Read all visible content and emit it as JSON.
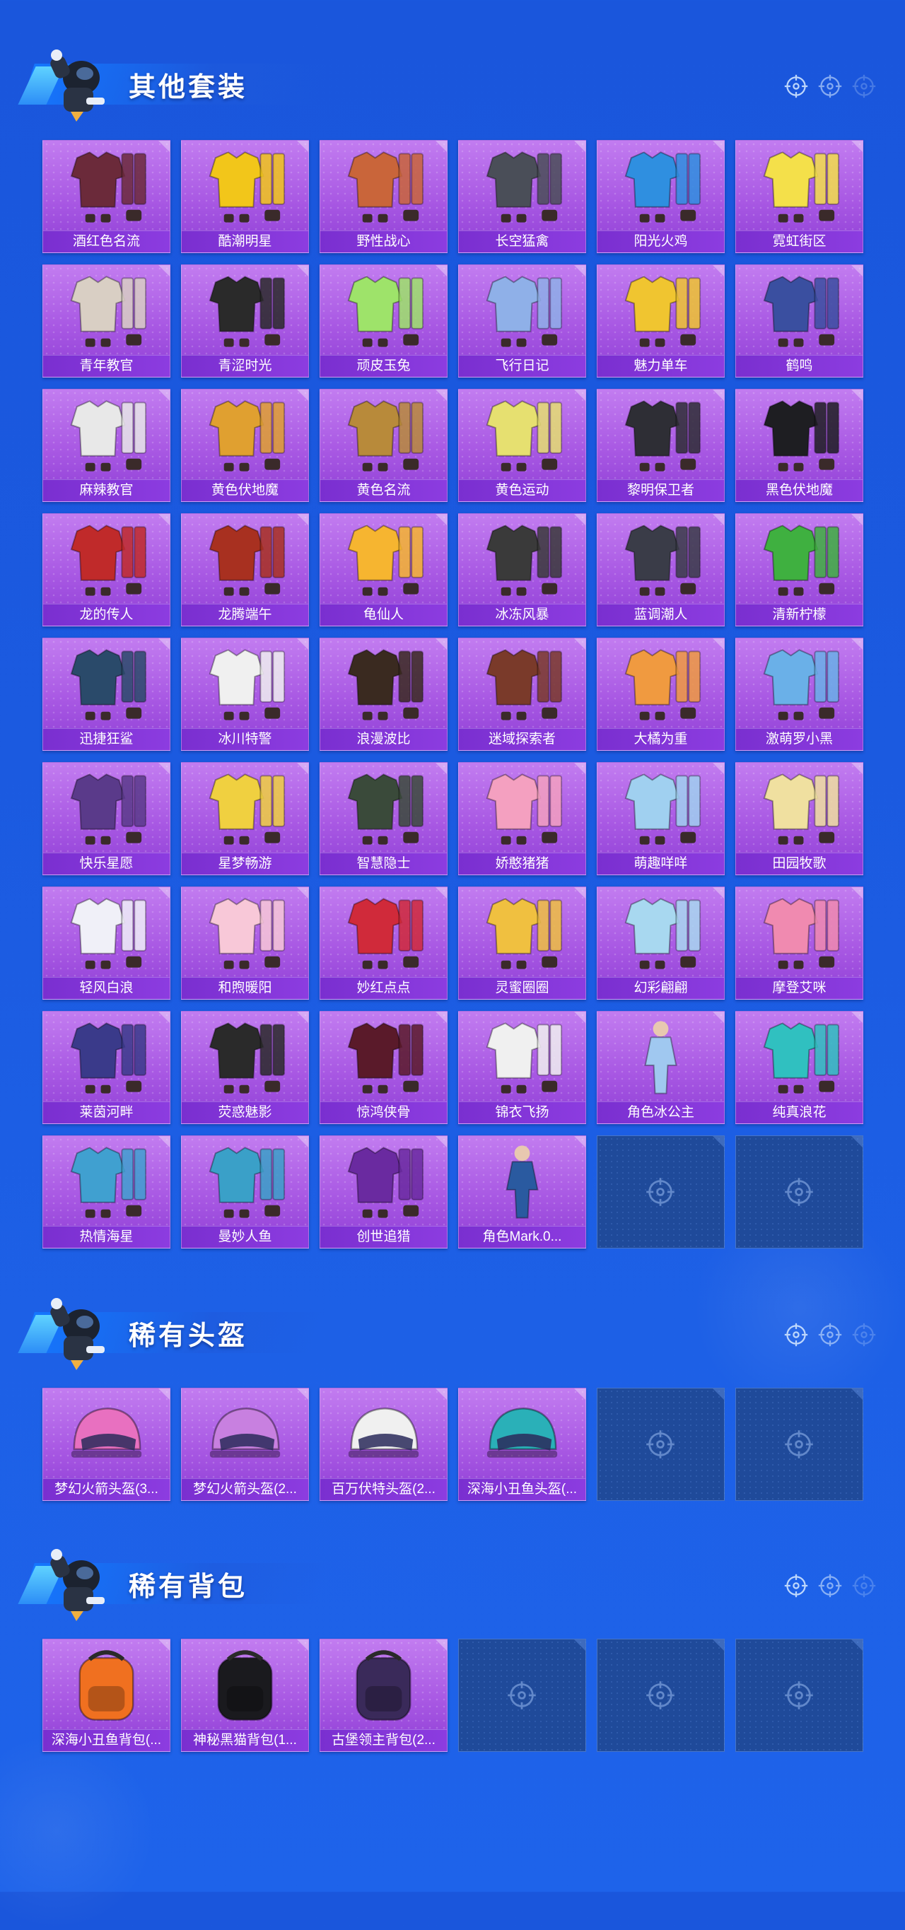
{
  "colors": {
    "background": "#1b5ae0",
    "card_top": "#c27cf0",
    "card_bottom": "#8f3fd6",
    "label_bar": "#7a2fd0",
    "empty_slot": "#1f4a9a"
  },
  "sections": [
    {
      "title": "其他套装",
      "items": [
        {
          "label": "酒红色名流",
          "icon": "outfit-icon",
          "color": "#6b2a3a"
        },
        {
          "label": "酷潮明星",
          "icon": "outfit-icon",
          "color": "#f2c61a"
        },
        {
          "label": "野性战心",
          "icon": "outfit-icon",
          "color": "#c9653a"
        },
        {
          "label": "长空猛禽",
          "icon": "outfit-icon",
          "color": "#4a4e58"
        },
        {
          "label": "阳光火鸡",
          "icon": "outfit-icon",
          "color": "#2f8fe0"
        },
        {
          "label": "霓虹街区",
          "icon": "outfit-icon",
          "color": "#f4e04a"
        },
        {
          "label": "青年教官",
          "icon": "outfit-icon",
          "color": "#d9cfc4"
        },
        {
          "label": "青涩时光",
          "icon": "outfit-icon",
          "color": "#2a2a2a"
        },
        {
          "label": "顽皮玉兔",
          "icon": "outfit-icon",
          "color": "#9ee36a"
        },
        {
          "label": "飞行日记",
          "icon": "outfit-icon",
          "color": "#8fb0e8"
        },
        {
          "label": "魅力单车",
          "icon": "outfit-icon",
          "color": "#f0c530"
        },
        {
          "label": "鹤鸣",
          "icon": "outfit-icon",
          "color": "#3a4fa0"
        },
        {
          "label": "麻辣教官",
          "icon": "outfit-icon",
          "color": "#e8e8e8"
        },
        {
          "label": "黄色伏地魔",
          "icon": "outfit-icon",
          "color": "#e0a030"
        },
        {
          "label": "黄色名流",
          "icon": "outfit-icon",
          "color": "#b88a3a"
        },
        {
          "label": "黄色运动",
          "icon": "outfit-icon",
          "color": "#e6e070"
        },
        {
          "label": "黎明保卫者",
          "icon": "outfit-icon",
          "color": "#2e2e35"
        },
        {
          "label": "黑色伏地魔",
          "icon": "outfit-icon",
          "color": "#1e1e22"
        },
        {
          "label": "龙的传人",
          "icon": "outfit-icon",
          "color": "#c02a2a"
        },
        {
          "label": "龙腾端午",
          "icon": "outfit-icon",
          "color": "#a83020"
        },
        {
          "label": "龟仙人",
          "icon": "outfit-icon",
          "color": "#f6b530"
        },
        {
          "label": "冰冻风暴",
          "icon": "outfit-icon",
          "color": "#3a3a3a"
        },
        {
          "label": "蓝调潮人",
          "icon": "outfit-icon",
          "color": "#3a3c48"
        },
        {
          "label": "清新柠檬",
          "icon": "outfit-icon",
          "color": "#3fb040"
        },
        {
          "label": "迅捷狂鲨",
          "icon": "outfit-icon",
          "color": "#2a4a6a"
        },
        {
          "label": "冰川特警",
          "icon": "outfit-icon",
          "color": "#f0f0f0"
        },
        {
          "label": "浪漫波比",
          "icon": "outfit-icon",
          "color": "#3a2a20"
        },
        {
          "label": "迷域探索者",
          "icon": "outfit-icon",
          "color": "#7a3a2a"
        },
        {
          "label": "大橘为重",
          "icon": "outfit-icon",
          "color": "#f09a40"
        },
        {
          "label": "激萌罗小黑",
          "icon": "outfit-icon",
          "color": "#6ab0e8"
        },
        {
          "label": "快乐星愿",
          "icon": "outfit-icon",
          "color": "#5a3a8a"
        },
        {
          "label": "星梦畅游",
          "icon": "outfit-icon",
          "color": "#f0d040"
        },
        {
          "label": "智慧隐士",
          "icon": "outfit-icon",
          "color": "#3a4a3a"
        },
        {
          "label": "娇憨猪猪",
          "icon": "outfit-icon",
          "color": "#f4a0c0"
        },
        {
          "label": "萌趣咩咩",
          "icon": "outfit-icon",
          "color": "#a0d0f0"
        },
        {
          "label": "田园牧歌",
          "icon": "outfit-icon",
          "color": "#f0e0a0"
        },
        {
          "label": "轻风白浪",
          "icon": "outfit-icon",
          "color": "#f0f0f8"
        },
        {
          "label": "和煦暖阳",
          "icon": "outfit-icon",
          "color": "#f8c8d8"
        },
        {
          "label": "妙红点点",
          "icon": "outfit-icon",
          "color": "#d02a3a"
        },
        {
          "label": "灵蜜圈圈",
          "icon": "outfit-icon",
          "color": "#f0c040"
        },
        {
          "label": "幻彩翩翩",
          "icon": "outfit-icon",
          "color": "#a8d8f0"
        },
        {
          "label": "摩登艾咪",
          "icon": "outfit-icon",
          "color": "#f08ab0"
        },
        {
          "label": "莱茵河畔",
          "icon": "outfit-icon",
          "color": "#3a3a8a"
        },
        {
          "label": "荧惑魅影",
          "icon": "outfit-icon",
          "color": "#2a2a2a"
        },
        {
          "label": "惊鸿侠骨",
          "icon": "outfit-icon",
          "color": "#5a1a2a"
        },
        {
          "label": "锦衣飞扬",
          "icon": "outfit-icon",
          "color": "#f0f0f0"
        },
        {
          "label": "角色冰公主",
          "icon": "figure-icon",
          "color": "#a0c8f0"
        },
        {
          "label": "纯真浪花",
          "icon": "outfit-icon",
          "color": "#30c0c0"
        },
        {
          "label": "热情海星",
          "icon": "outfit-icon",
          "color": "#40a0d0"
        },
        {
          "label": "曼妙人鱼",
          "icon": "outfit-icon",
          "color": "#3aa0c8"
        },
        {
          "label": "创世追猎",
          "icon": "outfit-icon",
          "color": "#6a2aa0"
        },
        {
          "label": "角色Mark.0...",
          "icon": "figure-icon",
          "color": "#2a5aa0"
        }
      ],
      "empty_slots": 2
    },
    {
      "title": "稀有头盔",
      "items": [
        {
          "label": "梦幻火箭头盔(3...",
          "icon": "helmet-icon",
          "color": "#e870c0"
        },
        {
          "label": "梦幻火箭头盔(2...",
          "icon": "helmet-icon",
          "color": "#c880e0"
        },
        {
          "label": "百万伏特头盔(2...",
          "icon": "helmet-icon",
          "color": "#f0f0f0"
        },
        {
          "label": "深海小丑鱼头盔(...",
          "icon": "helmet-icon",
          "color": "#2ab0b8"
        }
      ],
      "empty_slots": 2
    },
    {
      "title": "稀有背包",
      "items": [
        {
          "label": "深海小丑鱼背包(...",
          "icon": "backpack-icon",
          "color": "#f07020"
        },
        {
          "label": "神秘黑猫背包(1...",
          "icon": "backpack-icon",
          "color": "#1a1a1e"
        },
        {
          "label": "古堡领主背包(2...",
          "icon": "backpack-icon",
          "color": "#3a2a5a"
        }
      ],
      "empty_slots": 3
    }
  ]
}
